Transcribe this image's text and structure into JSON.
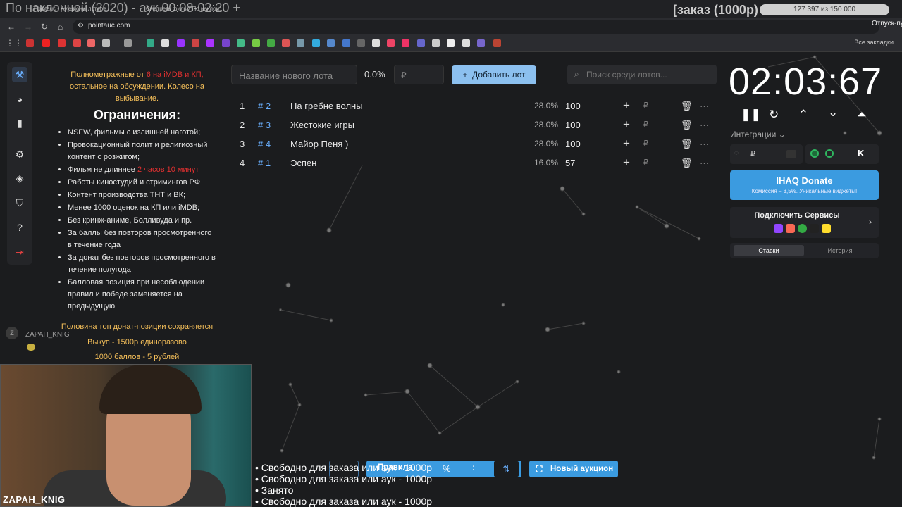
{
  "stream": {
    "title": "По наклонной (2020) - аук 00:08-02:20 +",
    "order_text": "[заказ (1000р)",
    "progress_text": "127 397 из 150 000",
    "progress_fraction": 0.849,
    "vacation_text": "Отпуск-путешествия",
    "webcam_name": "ZAPAH_KNIG",
    "ticker": [
      "• Свободно для заказа или аук - 1000р",
      "• Свободно для заказа или аук - 1000р",
      "• Занято",
      "• Свободно для заказа или аук - 1000р"
    ]
  },
  "browser": {
    "tabs": [
      "Pointauc - Аукционы лотере...",
      "Смотреть фильм По наклон..."
    ],
    "url": "pointauc.com",
    "all_bookmarks": "Все закладки"
  },
  "rules": {
    "intro_prefix": "Полнометражные от ",
    "intro_red": "6 на iMDB и КП,",
    "intro_suffix": "остальное на обсуждении. Колесо на выбывание.",
    "heading": "Ограничения:",
    "items": [
      "NSFW, фильмы с излишней наготой;",
      "Провокационный полит и религиозный контент с розжигом;",
      "Фильм не длиннее ",
      "Работы киностудий и стримингов РФ",
      "Контент производства ТНТ и ВК;",
      "Менее 1000 оценок на КП или iMDB;",
      "Без кринж-аниме, Болливуда и пр.",
      "За баллы без повторов просмотренного в течение года",
      "За донат без повторов просмотренного в течение полугода",
      "Балловая позиция при несоблюдении правил и победе заменяется на предыдущую"
    ],
    "item3_red": "2 часов 10 минут",
    "footer": [
      "Половина топ донат-позиции сохраняется",
      "Выкуп - 1500р единоразово",
      "1000 баллов - 5 рублей"
    ]
  },
  "chat": {
    "avatar": "Z",
    "user": "ZAPAH_KNIG"
  },
  "auction": {
    "lot_name_placeholder": "Название нового лота",
    "percent": "0.0%",
    "currency": "₽",
    "add_lot": "Добавить лот",
    "search_placeholder": "Поиск среди лотов...",
    "lots": [
      {
        "idx": "1",
        "hash": "# 2",
        "name": "На гребне волны",
        "pct": "28.0%",
        "amount": "100",
        "rub": "₽"
      },
      {
        "idx": "2",
        "hash": "# 3",
        "name": "Жестокие игры",
        "pct": "28.0%",
        "amount": "100",
        "rub": "₽"
      },
      {
        "idx": "3",
        "hash": "# 4",
        "name": "Майор Пеня )",
        "pct": "28.0%",
        "amount": "100",
        "rub": "₽"
      },
      {
        "idx": "4",
        "hash": "# 1",
        "name": "Эспен",
        "pct": "16.0%",
        "amount": "57",
        "rub": "₽"
      }
    ]
  },
  "right": {
    "timer": "02:03:67",
    "integrations": "Интеграции",
    "integ_currency": "₽",
    "donate_title": "IHAQ Donate",
    "donate_sub": "Комиссия – 3,5%. Уникальные виджеты!",
    "services_title": "Подключить Сервисы",
    "tab_bets": "Ставки",
    "tab_history": "История"
  },
  "bottom": {
    "rules_label": "Правила",
    "new_auction": "Новый аукцион"
  },
  "colors": {
    "accent": "#3b9be0",
    "add_button": "#8cc0ef",
    "rules_yellow": "#f6c05a",
    "rules_red": "#e03030"
  }
}
